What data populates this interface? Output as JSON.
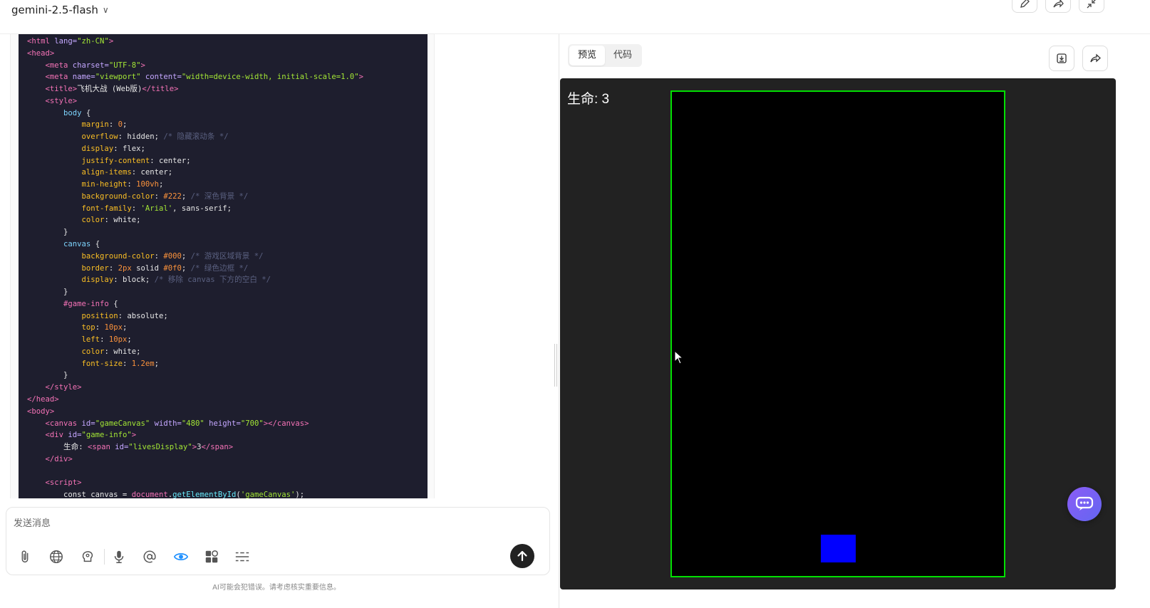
{
  "header": {
    "model": "gemini-2.5-flash"
  },
  "code_lines": [
    [
      [
        "c-tag",
        "<html "
      ],
      [
        "c-attr",
        "lang="
      ],
      [
        "c-str",
        "\"zh-CN\""
      ],
      [
        "c-tag",
        ">"
      ]
    ],
    [
      [
        "c-tag",
        "<head>"
      ]
    ],
    [
      [
        "c-kw",
        "    "
      ],
      [
        "c-tag",
        "<meta "
      ],
      [
        "c-attr",
        "charset="
      ],
      [
        "c-str",
        "\"UTF-8\""
      ],
      [
        "c-tag",
        ">"
      ]
    ],
    [
      [
        "c-kw",
        "    "
      ],
      [
        "c-tag",
        "<meta "
      ],
      [
        "c-attr",
        "name="
      ],
      [
        "c-str",
        "\"viewport\" "
      ],
      [
        "c-attr",
        "content="
      ],
      [
        "c-str",
        "\"width=device-width, initial-scale=1.0\""
      ],
      [
        "c-tag",
        ">"
      ]
    ],
    [
      [
        "c-kw",
        "    "
      ],
      [
        "c-tag",
        "<title>"
      ],
      [
        "c-kw",
        "飞机大战 (Web版)"
      ],
      [
        "c-tag",
        "</title>"
      ]
    ],
    [
      [
        "c-kw",
        "    "
      ],
      [
        "c-tag",
        "<style>"
      ]
    ],
    [
      [
        "c-kw",
        "        "
      ],
      [
        "c-sel",
        "body"
      ],
      [
        "c-kw",
        " {"
      ]
    ],
    [
      [
        "c-kw",
        "            "
      ],
      [
        "c-prop",
        "margin"
      ],
      [
        "c-kw",
        ": "
      ],
      [
        "c-num",
        "0"
      ],
      [
        "c-kw",
        ";"
      ]
    ],
    [
      [
        "c-kw",
        "            "
      ],
      [
        "c-prop",
        "overflow"
      ],
      [
        "c-kw",
        ": hidden; "
      ],
      [
        "c-com",
        "/* 隐藏滚动条 */"
      ]
    ],
    [
      [
        "c-kw",
        "            "
      ],
      [
        "c-prop",
        "display"
      ],
      [
        "c-kw",
        ": flex;"
      ]
    ],
    [
      [
        "c-kw",
        "            "
      ],
      [
        "c-prop",
        "justify-content"
      ],
      [
        "c-kw",
        ": center;"
      ]
    ],
    [
      [
        "c-kw",
        "            "
      ],
      [
        "c-prop",
        "align-items"
      ],
      [
        "c-kw",
        ": center;"
      ]
    ],
    [
      [
        "c-kw",
        "            "
      ],
      [
        "c-prop",
        "min-height"
      ],
      [
        "c-kw",
        ": "
      ],
      [
        "c-num",
        "100vh"
      ],
      [
        "c-kw",
        ";"
      ]
    ],
    [
      [
        "c-kw",
        "            "
      ],
      [
        "c-prop",
        "background-color"
      ],
      [
        "c-kw",
        ": "
      ],
      [
        "c-num",
        "#222"
      ],
      [
        "c-kw",
        "; "
      ],
      [
        "c-com",
        "/* 深色背景 */"
      ]
    ],
    [
      [
        "c-kw",
        "            "
      ],
      [
        "c-prop",
        "font-family"
      ],
      [
        "c-kw",
        ": "
      ],
      [
        "c-str",
        "'Arial'"
      ],
      [
        "c-kw",
        ", sans-serif;"
      ]
    ],
    [
      [
        "c-kw",
        "            "
      ],
      [
        "c-prop",
        "color"
      ],
      [
        "c-kw",
        ": white;"
      ]
    ],
    [
      [
        "c-kw",
        "        }"
      ]
    ],
    [
      [
        "c-kw",
        "        "
      ],
      [
        "c-sel",
        "canvas"
      ],
      [
        "c-kw",
        " {"
      ]
    ],
    [
      [
        "c-kw",
        "            "
      ],
      [
        "c-prop",
        "background-color"
      ],
      [
        "c-kw",
        ": "
      ],
      [
        "c-num",
        "#000"
      ],
      [
        "c-kw",
        "; "
      ],
      [
        "c-com",
        "/* 游戏区域背景 */"
      ]
    ],
    [
      [
        "c-kw",
        "            "
      ],
      [
        "c-prop",
        "border"
      ],
      [
        "c-kw",
        ": "
      ],
      [
        "c-num",
        "2px"
      ],
      [
        "c-kw",
        " solid "
      ],
      [
        "c-num",
        "#0f0"
      ],
      [
        "c-kw",
        "; "
      ],
      [
        "c-com",
        "/* 绿色边框 */"
      ]
    ],
    [
      [
        "c-kw",
        "            "
      ],
      [
        "c-prop",
        "display"
      ],
      [
        "c-kw",
        ": block; "
      ],
      [
        "c-com",
        "/* 移除 canvas 下方的空白 */"
      ]
    ],
    [
      [
        "c-kw",
        "        }"
      ]
    ],
    [
      [
        "c-kw",
        "        "
      ],
      [
        "c-tag",
        "#game-info"
      ],
      [
        "c-kw",
        " {"
      ]
    ],
    [
      [
        "c-kw",
        "            "
      ],
      [
        "c-prop",
        "position"
      ],
      [
        "c-kw",
        ": absolute;"
      ]
    ],
    [
      [
        "c-kw",
        "            "
      ],
      [
        "c-prop",
        "top"
      ],
      [
        "c-kw",
        ": "
      ],
      [
        "c-num",
        "10px"
      ],
      [
        "c-kw",
        ";"
      ]
    ],
    [
      [
        "c-kw",
        "            "
      ],
      [
        "c-prop",
        "left"
      ],
      [
        "c-kw",
        ": "
      ],
      [
        "c-num",
        "10px"
      ],
      [
        "c-kw",
        ";"
      ]
    ],
    [
      [
        "c-kw",
        "            "
      ],
      [
        "c-prop",
        "color"
      ],
      [
        "c-kw",
        ": white;"
      ]
    ],
    [
      [
        "c-kw",
        "            "
      ],
      [
        "c-prop",
        "font-size"
      ],
      [
        "c-kw",
        ": "
      ],
      [
        "c-num",
        "1.2em"
      ],
      [
        "c-kw",
        ";"
      ]
    ],
    [
      [
        "c-kw",
        "        }"
      ]
    ],
    [
      [
        "c-kw",
        "    "
      ],
      [
        "c-tag",
        "</style>"
      ]
    ],
    [
      [
        "c-tag",
        "</head>"
      ]
    ],
    [
      [
        "c-tag",
        "<body>"
      ]
    ],
    [
      [
        "c-kw",
        "    "
      ],
      [
        "c-tag",
        "<canvas "
      ],
      [
        "c-attr",
        "id="
      ],
      [
        "c-str",
        "\"gameCanvas\" "
      ],
      [
        "c-attr",
        "width="
      ],
      [
        "c-str",
        "\"480\" "
      ],
      [
        "c-attr",
        "height="
      ],
      [
        "c-str",
        "\"700\""
      ],
      [
        "c-tag",
        "></canvas>"
      ]
    ],
    [
      [
        "c-kw",
        "    "
      ],
      [
        "c-tag",
        "<div "
      ],
      [
        "c-attr",
        "id="
      ],
      [
        "c-str",
        "\"game-info\""
      ],
      [
        "c-tag",
        ">"
      ]
    ],
    [
      [
        "c-kw",
        "        生命: "
      ],
      [
        "c-tag",
        "<span "
      ],
      [
        "c-attr",
        "id="
      ],
      [
        "c-str",
        "\"livesDisplay\""
      ],
      [
        "c-tag",
        ">"
      ],
      [
        "c-kw",
        "3"
      ],
      [
        "c-tag",
        "</span>"
      ]
    ],
    [
      [
        "c-kw",
        "    "
      ],
      [
        "c-tag",
        "</div>"
      ]
    ],
    [
      [
        "c-kw",
        ""
      ]
    ],
    [
      [
        "c-kw",
        "    "
      ],
      [
        "c-tag",
        "<script>"
      ]
    ],
    [
      [
        "c-kw",
        "        const canvas = "
      ],
      [
        "c-tag",
        "document"
      ],
      [
        "c-kw",
        "."
      ],
      [
        "c-fn",
        "getElementById"
      ],
      [
        "c-kw",
        "("
      ],
      [
        "c-str",
        "'gameCanvas'"
      ],
      [
        "c-kw",
        ");"
      ]
    ]
  ],
  "input": {
    "placeholder": "发送消息"
  },
  "disclaimer": "AI可能会犯错误。请考虑核实重要信息。",
  "preview": {
    "tabs": [
      "预览",
      "代码"
    ],
    "lives_text": "生命: 3"
  },
  "colors": {
    "canvas_border": "#00e000",
    "player": "#0000ff",
    "preview_bg": "#222222",
    "accent_eye": "#1e90ff"
  }
}
